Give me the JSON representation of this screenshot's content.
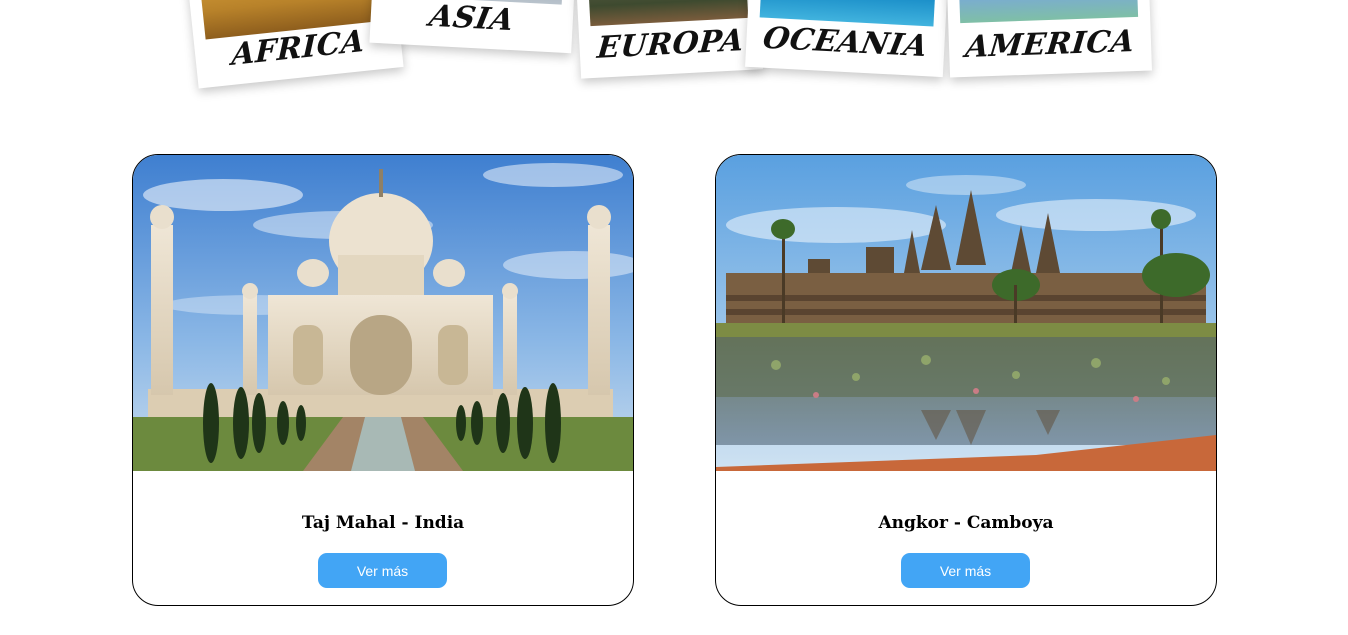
{
  "continents": [
    {
      "label": "AFRICA"
    },
    {
      "label": "ASIA"
    },
    {
      "label": "EUROPA"
    },
    {
      "label": "OCEANIA"
    },
    {
      "label": "AMERICA"
    }
  ],
  "cards": [
    {
      "title": "Taj Mahal - India",
      "button_label": "Ver más",
      "image": "taj-mahal-photo"
    },
    {
      "title": "Angkor - Camboya",
      "button_label": "Ver más",
      "image": "angkor-wat-photo"
    }
  ],
  "colors": {
    "button": "#42a5f5",
    "card_border": "#000000",
    "label_text": "#111111"
  }
}
